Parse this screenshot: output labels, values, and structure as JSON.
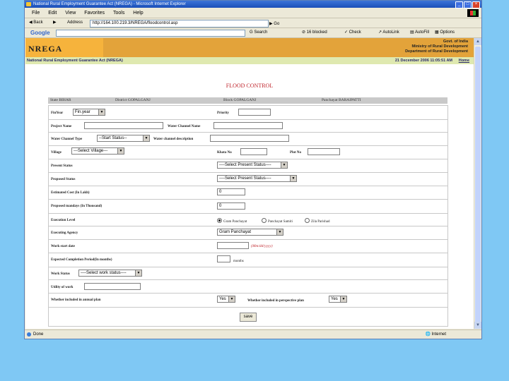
{
  "browser": {
    "title": "National Rural Employment Guarantee Act (NREGA) - Microsoft Internet Explorer",
    "menu": [
      "File",
      "Edit",
      "View",
      "Favorites",
      "Tools",
      "Help"
    ],
    "back_label": "Back",
    "address_label": "Address",
    "address": "http://164.100.219.3/NREGA/floodcontrol.asp",
    "go_label": "Go",
    "google": {
      "logo": "Google",
      "search_label": "Search",
      "blocked_label": "16 blocked",
      "check_label": "Check",
      "autolink_label": "AutoLink",
      "autofill_label": "AutoFill",
      "options_label": "Options"
    },
    "status_text": "Done",
    "zone_text": "Internet"
  },
  "header": {
    "logo_text": "NREGA",
    "gov_lines": [
      "Govt. of India",
      "Ministry of Rural Development",
      "Department of Rural Development"
    ],
    "act_title": "National Rural Employment Guarantee Act (NREGA)",
    "date": "21 December 2006 11:05:51 AM",
    "home_link": "Home"
  },
  "page_title": "FLOOD CONTROL",
  "location": {
    "state": "State BIHAR",
    "district": "District GOPALGANJ",
    "block": "Block GOPALGANJ",
    "panchayat": "Panchayat BARAIPATTI"
  },
  "form": {
    "fin_year_label": "FinYear",
    "fin_year_value": "Fin.year",
    "priority_label": "Priority",
    "project_name_label": "Project Name",
    "water_channel_name_label": "Water Channel Name",
    "water_channel_type_label": "Water Channel Type",
    "water_channel_type_value": "--Start Status--",
    "water_channel_desc_label": "Water channel description",
    "village_label": "Village",
    "village_value": "---Select Village---",
    "khata_label": "Khata No",
    "plot_label": "Plot No",
    "present_status_label": "Present Status",
    "present_status_value": "----Select Present Status----",
    "proposed_status_label": "Proposed Status",
    "proposed_status_value": "----Select Present Status----",
    "estimated_cost_label": "Estimated Cost (In Lakh)",
    "estimated_cost_value": "0",
    "mandays_label": "Proposed mandays (In Thousand)",
    "mandays_value": "0",
    "execution_level_label": "Execution Level",
    "execution_options": [
      "Gram Panchayat",
      "Panchayat Samiti",
      "Zila Parishad"
    ],
    "executing_agency_label": "Executing Agency",
    "executing_agency_value": "Gram Panchayat",
    "work_start_label": "Work start date",
    "work_start_hint": "(Mm/dd/yyyy)",
    "completion_label": "Expected Completion Period(In months)",
    "completion_unit": "months",
    "work_status_label": "Work Status",
    "work_status_value": "----Select work status----",
    "utility_label": "Utility of work",
    "annual_plan_label": "Whether included in annual plan",
    "annual_plan_value": "Yes",
    "perspective_plan_label": "Whether included in perspective plan",
    "perspective_plan_value": "Yes",
    "save_label": "save"
  }
}
